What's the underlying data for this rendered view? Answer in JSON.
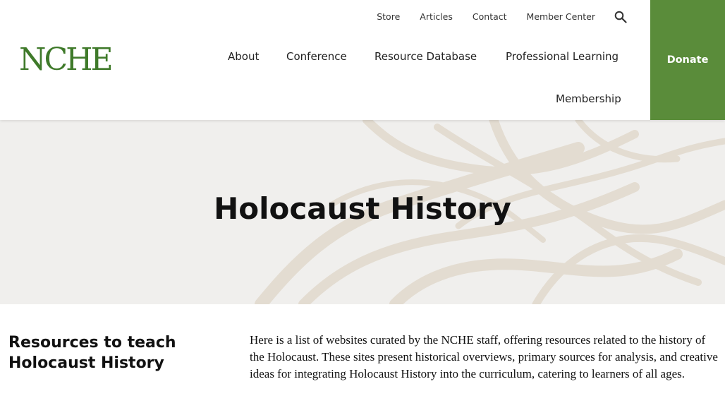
{
  "colors": {
    "brand_green": "#3f7a2a",
    "donate_bg": "#5a8c3a",
    "hero_bg": "#f0efed",
    "hero_pattern": "#e3dcd1"
  },
  "header": {
    "logo_text": "NCHE",
    "top_links": [
      "Store",
      "Articles",
      "Contact",
      "Member Center"
    ],
    "search_icon": "search-icon",
    "main_nav": [
      "About",
      "Conference",
      "Resource Database",
      "Professional Learning",
      "Membership"
    ],
    "donate_label": "Donate"
  },
  "hero": {
    "title": "Holocaust History"
  },
  "content": {
    "heading": "Resources to teach Holocaust History",
    "body": "Here is a list of websites curated by the NCHE staff, offering resources related to the history of the Holocaust. These sites present historical overviews, primary sources for analysis, and creative ideas for integrating Holocaust History into the curriculum, catering to learners of all ages."
  }
}
